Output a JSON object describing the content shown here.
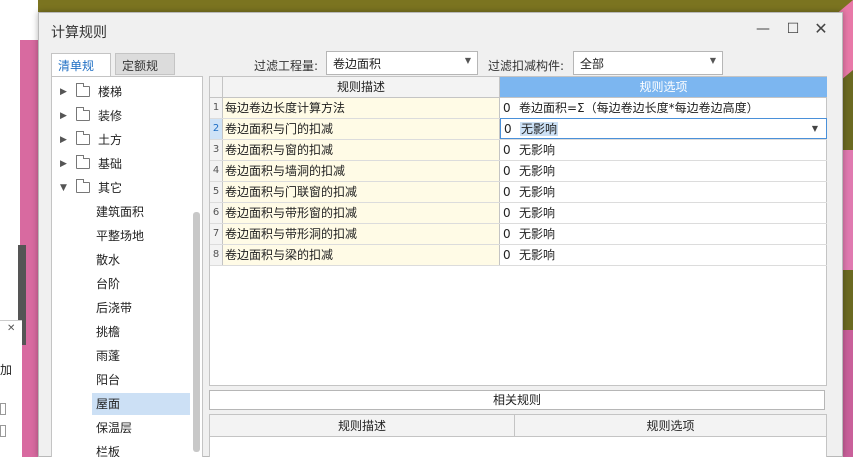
{
  "window": {
    "title": "计算规则",
    "controls": {
      "minimize": "—",
      "maximize": "☐",
      "close": "✕"
    }
  },
  "tabs": [
    {
      "label": "清单规则",
      "active": true
    },
    {
      "label": "定额规则",
      "active": false
    }
  ],
  "filters": {
    "quantity_label": "过滤工程量:",
    "quantity_value": "卷边面积",
    "deduct_label": "过滤扣减构件:",
    "deduct_value": "全部"
  },
  "tree": {
    "folders": [
      {
        "label": "楼梯",
        "expanded": false
      },
      {
        "label": "装修",
        "expanded": false
      },
      {
        "label": "土方",
        "expanded": false
      },
      {
        "label": "基础",
        "expanded": false
      },
      {
        "label": "其它",
        "expanded": true
      }
    ],
    "leaves": [
      {
        "label": "建筑面积"
      },
      {
        "label": "平整场地"
      },
      {
        "label": "散水"
      },
      {
        "label": "台阶"
      },
      {
        "label": "后浇带"
      },
      {
        "label": "挑檐"
      },
      {
        "label": "雨蓬"
      },
      {
        "label": "阳台"
      },
      {
        "label": "屋面",
        "selected": true
      },
      {
        "label": "保温层"
      },
      {
        "label": "栏板"
      }
    ]
  },
  "grid": {
    "headers": {
      "desc": "规则描述",
      "option": "规则选项"
    },
    "rows": [
      {
        "num": "1",
        "desc": "每边卷边长度计算方法",
        "code": "0",
        "value": "卷边面积=Σ（每边卷边长度*每边卷边高度）"
      },
      {
        "num": "2",
        "desc": "卷边面积与门的扣减",
        "code": "0",
        "value": "无影响",
        "active": true
      },
      {
        "num": "3",
        "desc": "卷边面积与窗的扣减",
        "code": "0",
        "value": "无影响"
      },
      {
        "num": "4",
        "desc": "卷边面积与墙洞的扣减",
        "code": "0",
        "value": "无影响"
      },
      {
        "num": "5",
        "desc": "卷边面积与门联窗的扣减",
        "code": "0",
        "value": "无影响"
      },
      {
        "num": "6",
        "desc": "卷边面积与带形窗的扣减",
        "code": "0",
        "value": "无影响"
      },
      {
        "num": "7",
        "desc": "卷边面积与带形洞的扣减",
        "code": "0",
        "value": "无影响"
      },
      {
        "num": "8",
        "desc": "卷边面积与梁的扣减",
        "code": "0",
        "value": "无影响"
      }
    ]
  },
  "related": {
    "button_label": "相关规则",
    "headers": {
      "desc": "规则描述",
      "option": "规则选项"
    }
  },
  "background": {
    "side_panel_text": "加",
    "side_panel_close": "✕"
  },
  "colors": {
    "accent": "#1f6fc4",
    "header_highlight": "#7cb6f0",
    "desc_cell_bg": "#fffbe6",
    "selection_bg": "#cce0f5"
  }
}
